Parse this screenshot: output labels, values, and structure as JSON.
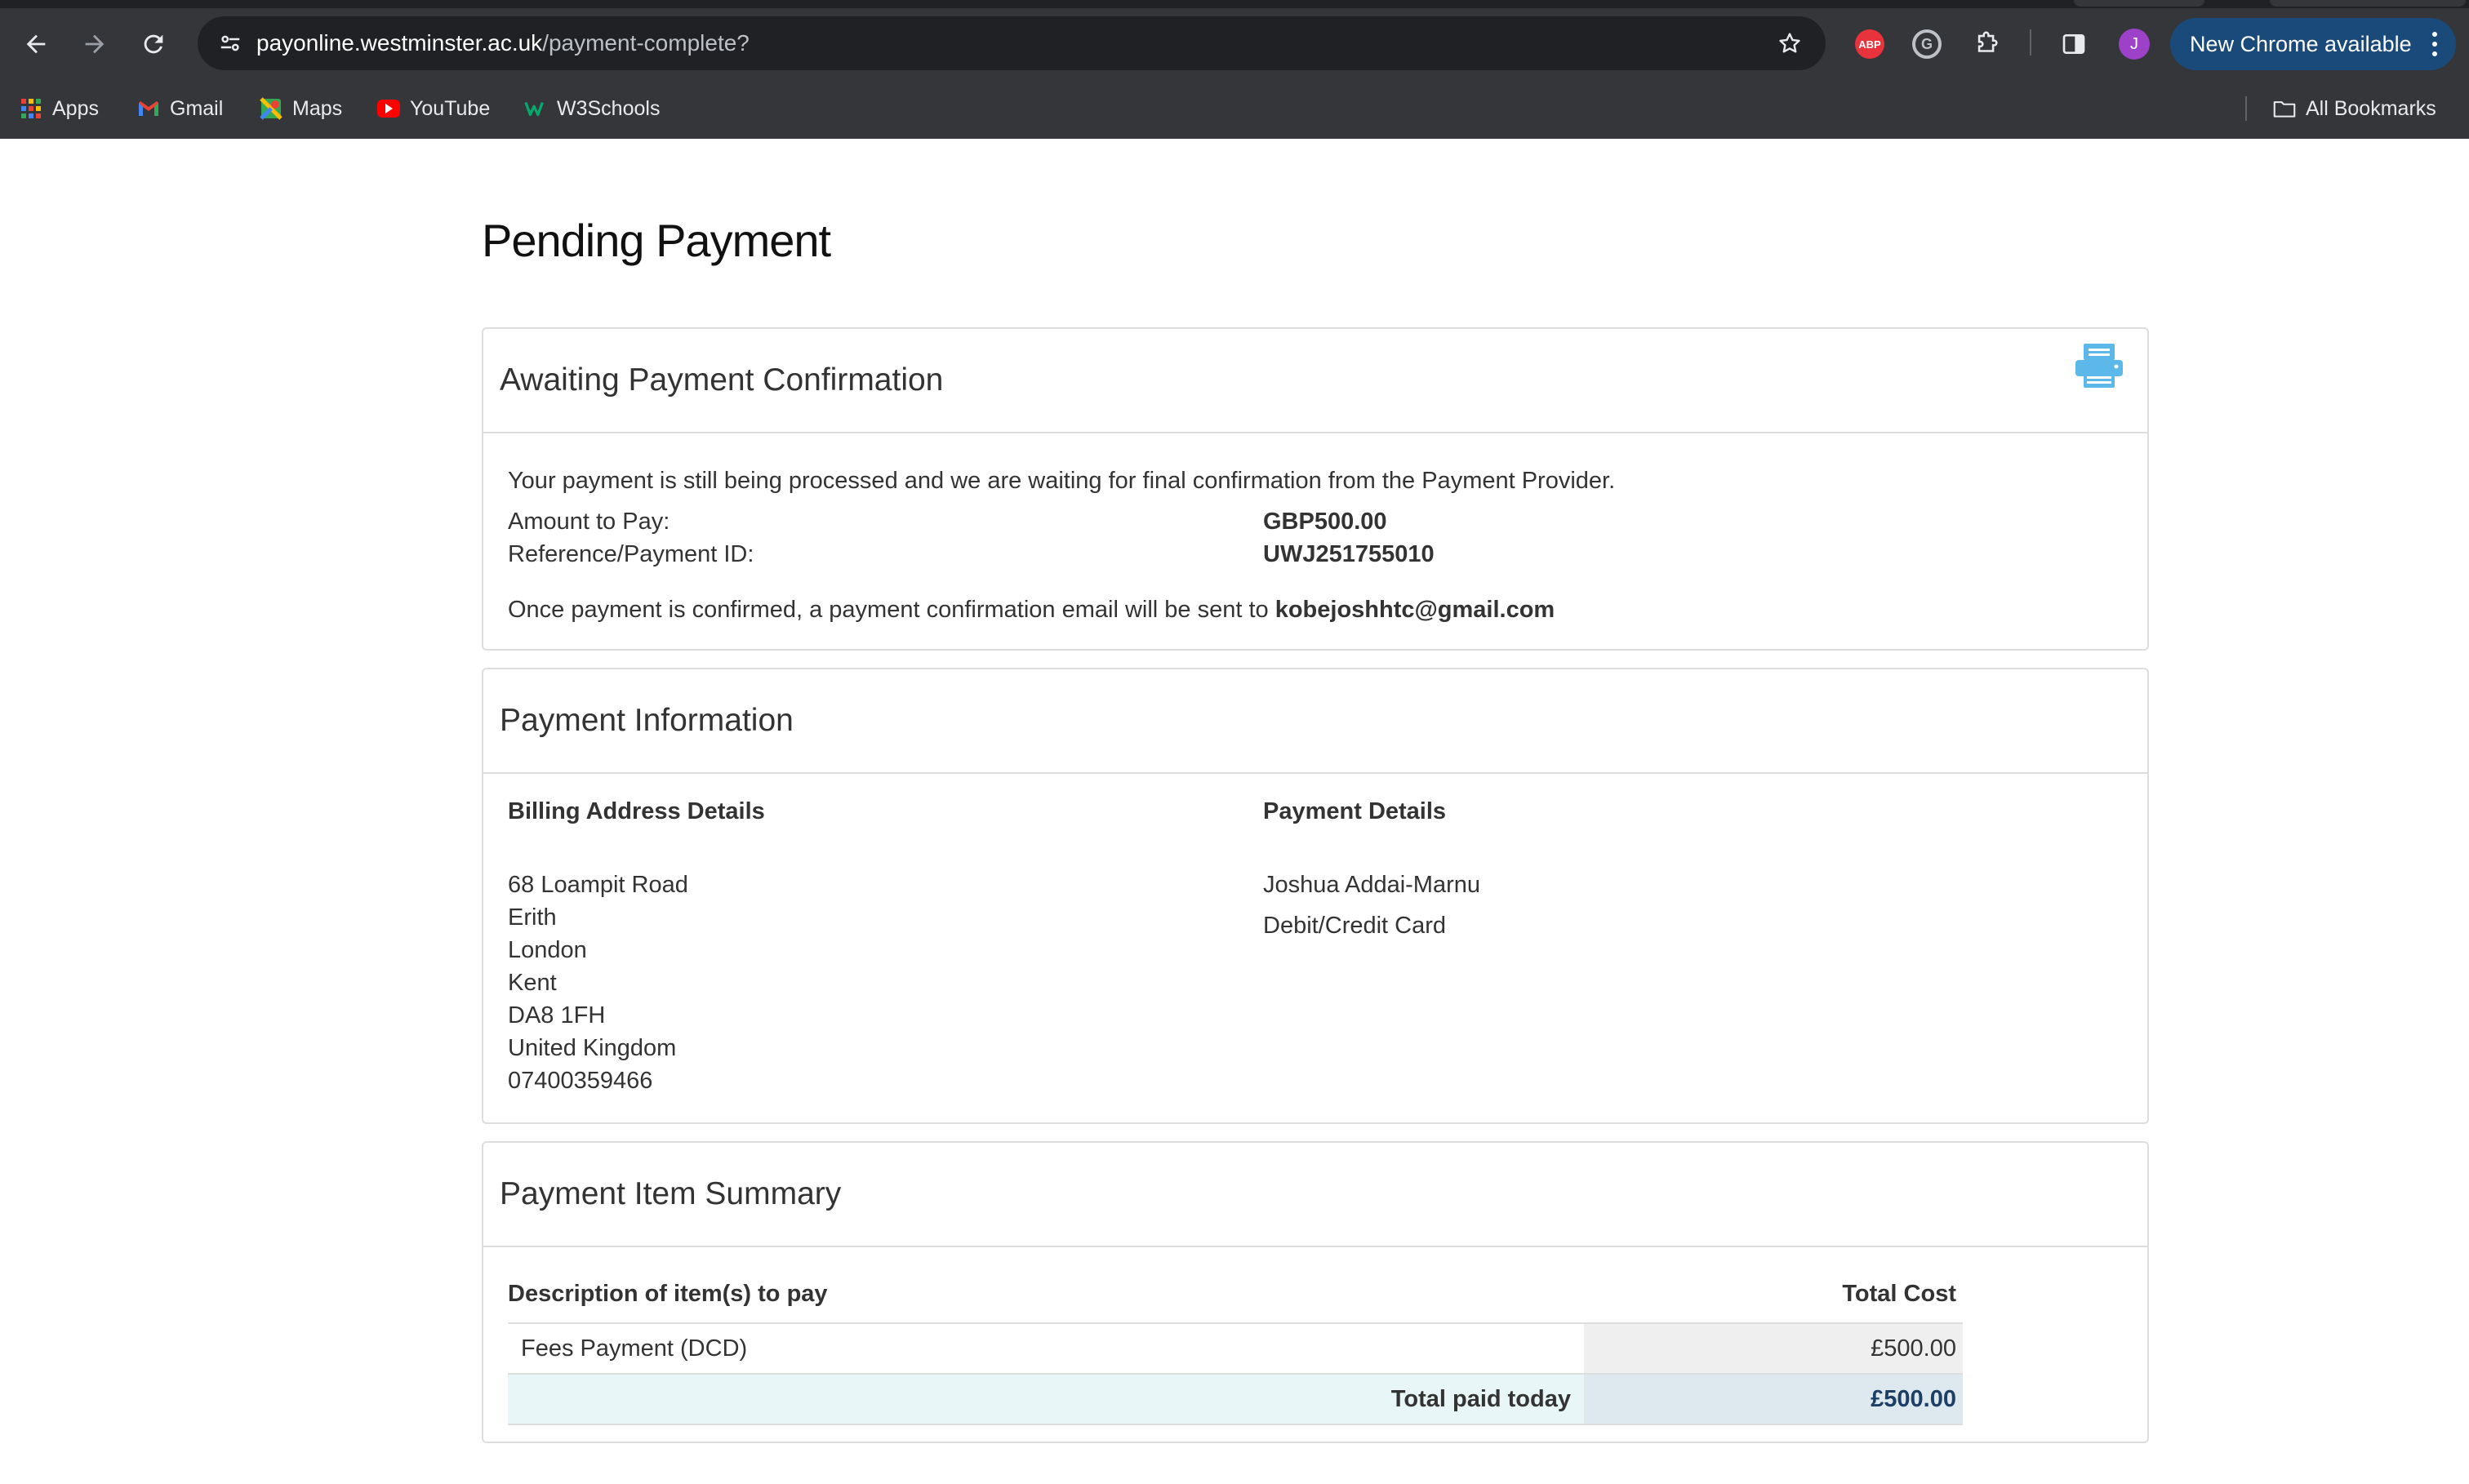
{
  "browser": {
    "url_host": "payonline.westminster.ac.uk",
    "url_path": "/payment-complete?",
    "profile_initial": "J",
    "update_button_label": "New Chrome available",
    "extensions": [
      {
        "name": "adblock-plus",
        "label": "ABP"
      },
      {
        "name": "grammarly",
        "label": "G"
      }
    ],
    "bookmarks": [
      {
        "label": "Apps",
        "icon": "apps-grid-icon"
      },
      {
        "label": "Gmail",
        "icon": "gmail-icon"
      },
      {
        "label": "Maps",
        "icon": "maps-icon"
      },
      {
        "label": "YouTube",
        "icon": "youtube-icon"
      },
      {
        "label": "W3Schools",
        "icon": "w3schools-icon"
      }
    ],
    "all_bookmarks_label": "All Bookmarks"
  },
  "page": {
    "title": "Pending Payment"
  },
  "awaiting": {
    "heading": "Awaiting Payment Confirmation",
    "message": "Your payment is still being processed and we are waiting for final confirmation from the Payment Provider.",
    "amount_label": "Amount to Pay:",
    "amount_value": "GBP500.00",
    "reference_label": "Reference/Payment ID:",
    "reference_value": "UWJ251755010",
    "email_note": "Once payment is confirmed, a payment confirmation email will be sent to",
    "email": "kobejoshhtc@gmail.com",
    "print_icon": "printer-icon"
  },
  "payment_info": {
    "heading": "Payment Information",
    "billing_heading": "Billing Address Details",
    "billing_lines": [
      "68 Loampit Road",
      "Erith",
      "London",
      "Kent",
      "DA8 1FH",
      "United Kingdom",
      "07400359466"
    ],
    "details_heading": "Payment Details",
    "payer_name": "Joshua Addai-Marnu",
    "payment_method": "Debit/Credit Card"
  },
  "summary": {
    "heading": "Payment Item Summary",
    "col_description": "Description of item(s) to pay",
    "col_total": "Total Cost",
    "items": [
      {
        "description": "Fees Payment (DCD)",
        "cost": "£500.00"
      }
    ],
    "total_label": "Total paid today",
    "total_value": "£500.00"
  },
  "colors": {
    "chrome_bg": "#35363a",
    "omnibox_bg": "#202124",
    "update_button": "#1a4a7a",
    "printer_icon": "#5bb8e8",
    "total_row": "#e8f6f8"
  }
}
